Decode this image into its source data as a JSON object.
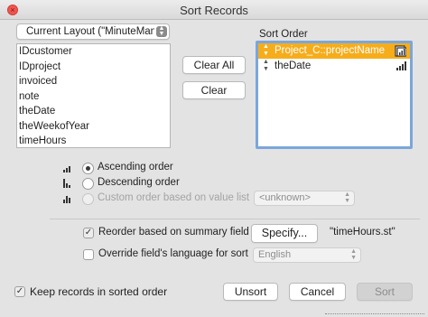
{
  "window": {
    "title": "Sort Records"
  },
  "layout_popup": {
    "value": "Current Layout (\"MinuteMana..."
  },
  "fields": [
    "IDcustomer",
    "IDproject",
    "invoiced",
    "note",
    "theDate",
    "theWeekofYear",
    "timeHours"
  ],
  "buttons": {
    "clear_all": "Clear All",
    "clear": "Clear",
    "specify": "Specify...",
    "unsort": "Unsort",
    "cancel": "Cancel",
    "sort": "Sort"
  },
  "sort_order": {
    "label": "Sort Order",
    "items": [
      {
        "label": "Project_C::projectName",
        "selected": true,
        "icon": "custom-order-icon"
      },
      {
        "label": "theDate",
        "selected": false,
        "icon": "ascending-bars-icon"
      }
    ]
  },
  "order_options": {
    "ascending": "Ascending order",
    "descending": "Descending order",
    "custom": "Custom order based on value list",
    "custom_value": "<unknown>",
    "selected": "ascending"
  },
  "summary": {
    "reorder_label": "Reorder based on summary field",
    "reorder_checked": true,
    "summary_field": "\"timeHours.st\"",
    "override_label": "Override field's language for sort",
    "override_checked": false,
    "language": "English"
  },
  "keep_sorted": {
    "label": "Keep records in sorted order",
    "checked": true
  },
  "colors": {
    "selection": "#f6ad1c",
    "focus_ring": "#7ba6db"
  }
}
